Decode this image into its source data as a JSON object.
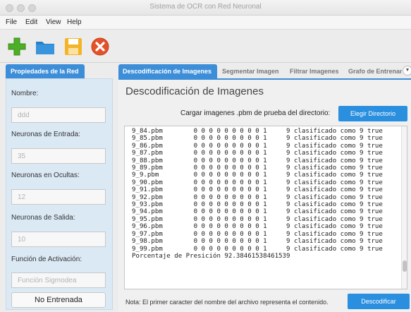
{
  "window": {
    "title": "Sistema de OCR con Red Neuronal"
  },
  "menu": [
    "File",
    "Edit",
    "View",
    "Help"
  ],
  "toolbar": {
    "icons": [
      "add-icon",
      "folder-icon",
      "save-icon",
      "close-icon"
    ],
    "colors": {
      "add": "#4caf28",
      "folder": "#2a80c8",
      "save": "#f3b428",
      "close": "#e4522a"
    }
  },
  "left_panel": {
    "tab_label": "Propiedades de la Red",
    "fields": [
      {
        "label": "Nombre:",
        "value": "ddd"
      },
      {
        "label": "Neuronas de Entrada:",
        "value": "35"
      },
      {
        "label": "Neuronas en Ocultas:",
        "value": "12"
      },
      {
        "label": "Neuronas de Salida:",
        "value": "10"
      },
      {
        "label": "Función de Activación:",
        "value": "Función Sigmodea"
      }
    ],
    "status_button": "No Entrenada"
  },
  "tabs": [
    "Descodificación de Imagenes",
    "Segmentar Imagen",
    "Filtrar Imagenes",
    "Grafo de Entrenam"
  ],
  "main": {
    "title": "Descodificación de Imagenes",
    "load_label": "Cargar imagenes .pbm de prueba del directorio:",
    "choose_button": "Elegir Directorio",
    "output_lines": [
      "9_84.pbm        0 0 0 0 0 0 0 0 0 1     9 clasificado como 9 true",
      "9_85.pbm        0 0 0 0 0 0 0 0 0 1     9 clasificado como 9 true",
      "9_86.pbm        0 0 0 0 0 0 0 0 0 1     9 clasificado como 9 true",
      "9_87.pbm        0 0 0 0 0 0 0 0 0 1     9 clasificado como 9 true",
      "9_88.pbm        0 0 0 0 0 0 0 0 0 1     9 clasificado como 9 true",
      "9_89.pbm        0 0 0 0 0 0 0 0 0 1     9 clasificado como 9 true",
      "9_9.pbm         0 0 0 0 0 0 0 0 0 1     9 clasificado como 9 true",
      "9_90.pbm        0 0 0 0 0 0 0 0 0 1     9 clasificado como 9 true",
      "9_91.pbm        0 0 0 0 0 0 0 0 0 1     9 clasificado como 9 true",
      "9_92.pbm        0 0 0 0 0 0 0 0 0 1     9 clasificado como 9 true",
      "9_93.pbm        0 0 0 0 0 0 0 0 0 1     9 clasificado como 9 true",
      "9_94.pbm        0 0 0 0 0 0 0 0 0 1     9 clasificado como 9 true",
      "9_95.pbm        0 0 0 0 0 0 0 0 0 1     9 clasificado como 9 true",
      "9_96.pbm        0 0 0 0 0 0 0 0 0 1     9 clasificado como 9 true",
      "9_97.pbm        0 0 0 0 0 0 0 0 0 1     9 clasificado como 9 true",
      "9_98.pbm        0 0 0 0 0 0 0 0 0 1     9 clasificado como 9 true",
      "9_99.pbm        0 0 0 0 0 0 0 0 0 1     9 clasificado como 9 true",
      "Porcentaje de Presición 92.38461538461539"
    ],
    "note": "Nota: El primer caracter del nombre del archivo representa el contenido.",
    "decode_button": "Descodificar"
  }
}
